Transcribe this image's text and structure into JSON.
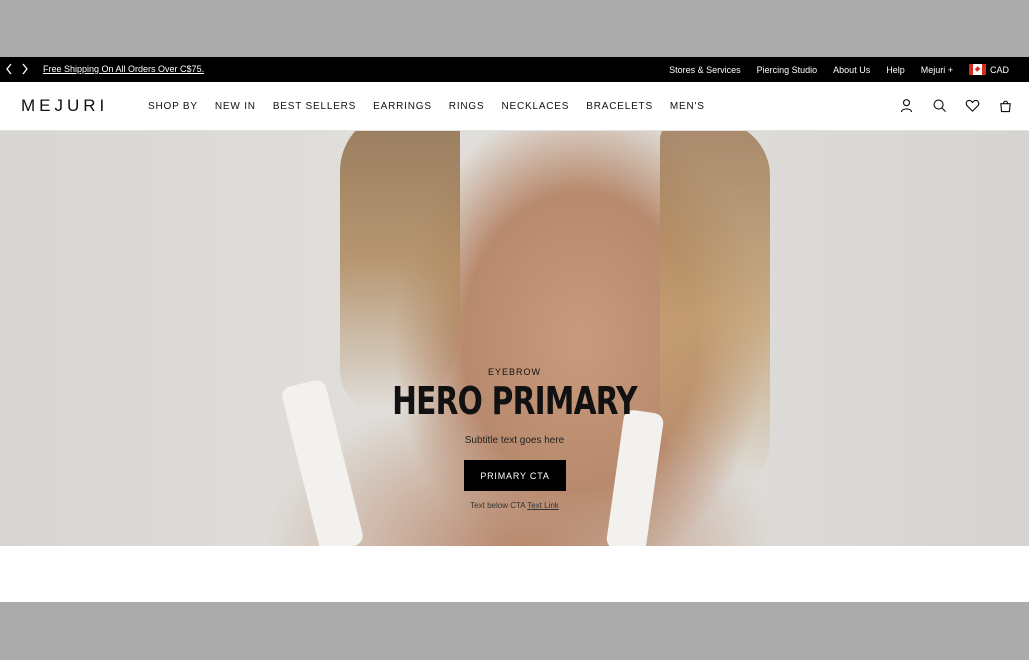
{
  "promo": {
    "message": "Free Shipping On All Orders Over C$75.",
    "prev_icon": "chevron-left-icon",
    "next_icon": "chevron-right-icon"
  },
  "utility_nav": {
    "items": [
      "Stores & Services",
      "Piercing Studio",
      "About Us",
      "Help",
      "Mejuri +"
    ],
    "currency": "CAD",
    "flag_icon": "canada-flag-icon"
  },
  "header": {
    "logo": "MEJURI",
    "nav": [
      "SHOP BY",
      "NEW IN",
      "BEST SELLERS",
      "EARRINGS",
      "RINGS",
      "NECKLACES",
      "BRACELETS",
      "MEN'S"
    ],
    "icons": [
      "account-icon",
      "search-icon",
      "heart-icon",
      "bag-icon"
    ]
  },
  "hero": {
    "eyebrow": "EYEBROW",
    "title": "HERO PRIMARY",
    "subtitle": "Subtitle text goes here",
    "cta_label": "PRIMARY CTA",
    "below_cta_text": "Text below CTA",
    "below_cta_link": "Text Link"
  },
  "colors": {
    "promo_bg": "#000000",
    "page_gray": "#ababab",
    "cta_bg": "#000000"
  }
}
